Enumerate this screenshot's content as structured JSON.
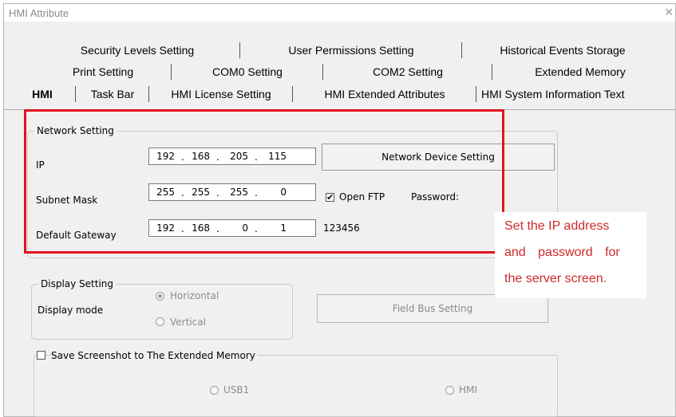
{
  "window": {
    "title": "HMI Attribute",
    "close_glyph": "✕"
  },
  "tabs": {
    "row1": [
      "Security Levels Setting",
      "User Permissions Setting",
      "Historical Events Storage"
    ],
    "row2": [
      "Print Setting",
      "COM0 Setting",
      "COM2 Setting",
      "Extended Memory"
    ],
    "row3": [
      "HMI",
      "Task Bar",
      "HMI License Setting",
      "HMI Extended Attributes",
      "HMI System Information Text"
    ],
    "active": "HMI"
  },
  "network": {
    "legend": "Network Setting",
    "ip_label": "IP",
    "ip": [
      "192",
      "168",
      "205",
      "115"
    ],
    "subnet_label": "Subnet Mask",
    "subnet": [
      "255",
      "255",
      "255",
      "0"
    ],
    "gateway_label": "Default Gateway",
    "gateway": [
      "192",
      "168",
      "0",
      "1"
    ],
    "device_button": "Network Device Setting",
    "ftp_label": "Open FTP",
    "ftp_checked": true,
    "password_label": "Password:",
    "password_value": "123456"
  },
  "display": {
    "legend": "Display Setting",
    "mode_label": "Display mode",
    "options": [
      "Horizontal",
      "Vertical"
    ],
    "selected": "Horizontal"
  },
  "fieldbus_button": "Field Bus Setting",
  "screenshot": {
    "label": "Save Screenshot to The Extended Memory",
    "checked": false,
    "options": [
      "USB1",
      "HMI"
    ]
  },
  "annotation": {
    "lines": [
      "Set the IP address",
      "and password for",
      "the server screen."
    ],
    "color": "#cc2a2a"
  },
  "highlight_color": "#e0141e"
}
